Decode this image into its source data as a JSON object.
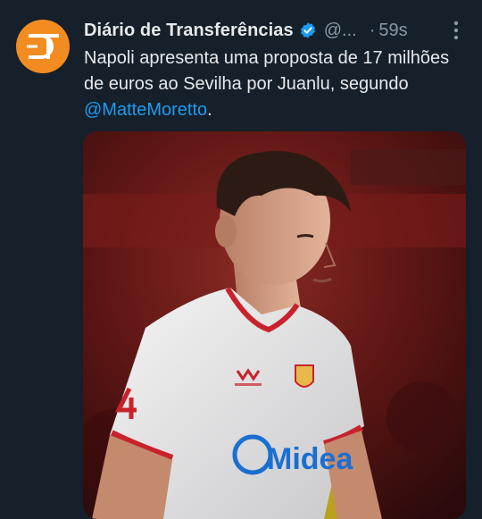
{
  "tweet": {
    "author_name": "Diário de Transferências",
    "handle": "@...",
    "separator": "·",
    "time": "59s",
    "text_before": "Napoli apresenta uma proposta de 17 milhões de euros ao Sevilha por Juanlu, segundo ",
    "mention": "@MatteMoretto",
    "text_after": ".",
    "avatar_initials": "DT"
  },
  "photo": {
    "jersey_sponsor": "Midea",
    "kit_brand": "Castore",
    "shirt_number": "4"
  },
  "colors": {
    "background": "#15202b",
    "avatar": "#f28c20",
    "verified": "#1d9bf0",
    "mention": "#1d9bf0",
    "muted_text": "#8b98a5"
  }
}
